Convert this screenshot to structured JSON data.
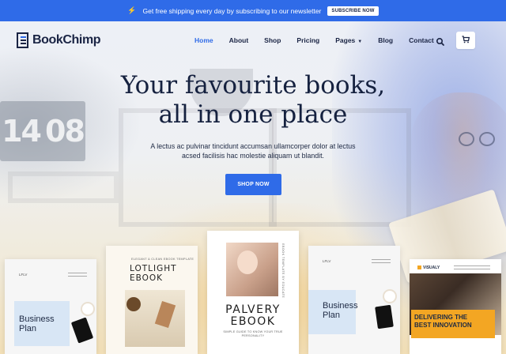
{
  "announcement": {
    "text": "Get free shipping every day by subscribing to our newsletter",
    "button": "SUBSCRIBE NOW",
    "icon": "bolt-icon"
  },
  "brand": {
    "name": "BookChimp",
    "logo_icon": "bookchimp-logo-icon"
  },
  "nav": {
    "items": [
      {
        "label": "Home",
        "active": true
      },
      {
        "label": "About"
      },
      {
        "label": "Shop"
      },
      {
        "label": "Pricing"
      },
      {
        "label": "Pages",
        "has_dropdown": true
      },
      {
        "label": "Blog"
      },
      {
        "label": "Contact"
      }
    ],
    "search_icon": "search-icon",
    "cart_icon": "cart-icon"
  },
  "hero": {
    "title_line1": "Your favourite books,",
    "title_line2": "all in one place",
    "subtitle_line1": "A lectus ac pulvinar tincidunt accumsan ullamcorper dolor at lectus",
    "subtitle_line2": "acsed facilisis hac molestie aliquam ut blandit.",
    "cta": "SHOP NOW"
  },
  "background": {
    "clock_hours": "14",
    "clock_minutes": "08"
  },
  "books": [
    {
      "tag": "LFLV",
      "title_line1": "Business",
      "title_line2": "Plan"
    },
    {
      "small": "ELEGANT & CLEAN EBOOK TEMPLATE",
      "title_line1": "LOTLIGHT",
      "title_line2": "EBOOK"
    },
    {
      "vertical": "EBOOK TEMPLATE BY EDUCATE",
      "title_line1": "PALVERY",
      "title_line2": "EBOOK",
      "sub": "SIMPLE GUIDE TO KNOW YOUR TRUE PERSONALITY"
    },
    {
      "tag": "LFLV",
      "title_line1": "Business",
      "title_line2": "Plan"
    },
    {
      "brand": "VISUALY",
      "title_line1": "DELIVERING THE",
      "title_line2": "BEST INNOVATION"
    }
  ],
  "colors": {
    "accent": "#2f6be8",
    "heading": "#15213f",
    "banner_orange": "#f3a623"
  }
}
